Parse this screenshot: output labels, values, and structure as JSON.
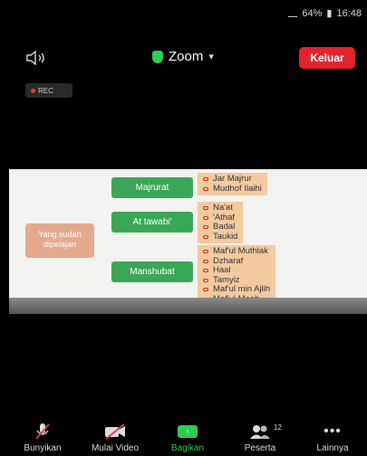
{
  "status_bar": {
    "battery": "64%",
    "time": "16:48"
  },
  "top_bar": {
    "title": "Zoom",
    "leave_label": "Keluar"
  },
  "rec_label": "REC",
  "slide": {
    "learned_label": "Yang sudah dipelajari",
    "categories": [
      {
        "label": "Majrurat",
        "items": [
          "Jar Majrur",
          "Mudhof Ilaihi"
        ]
      },
      {
        "label": "At tawabi'",
        "items": [
          "Na'at",
          "'Athaf",
          "Badal",
          "Taukid"
        ]
      },
      {
        "label": "Manshubat",
        "items": [
          "Maf'ul Muthlak",
          "Dzharaf",
          "Haal",
          "Tamyiz",
          "Maf'ul min Ajlih",
          "Maf'ul Maah"
        ]
      }
    ]
  },
  "toolbar": {
    "mute_label": "Bunyikan",
    "video_label": "Mulai Video",
    "share_label": "Bagikan",
    "participants_label": "Peserta",
    "participants_count": "12",
    "more_label": "Lainnya"
  },
  "colors": {
    "accent_green": "#2ecc52",
    "leave_red": "#e1242c",
    "category_green": "#3aa756",
    "item_bg": "#f3c9a0"
  }
}
